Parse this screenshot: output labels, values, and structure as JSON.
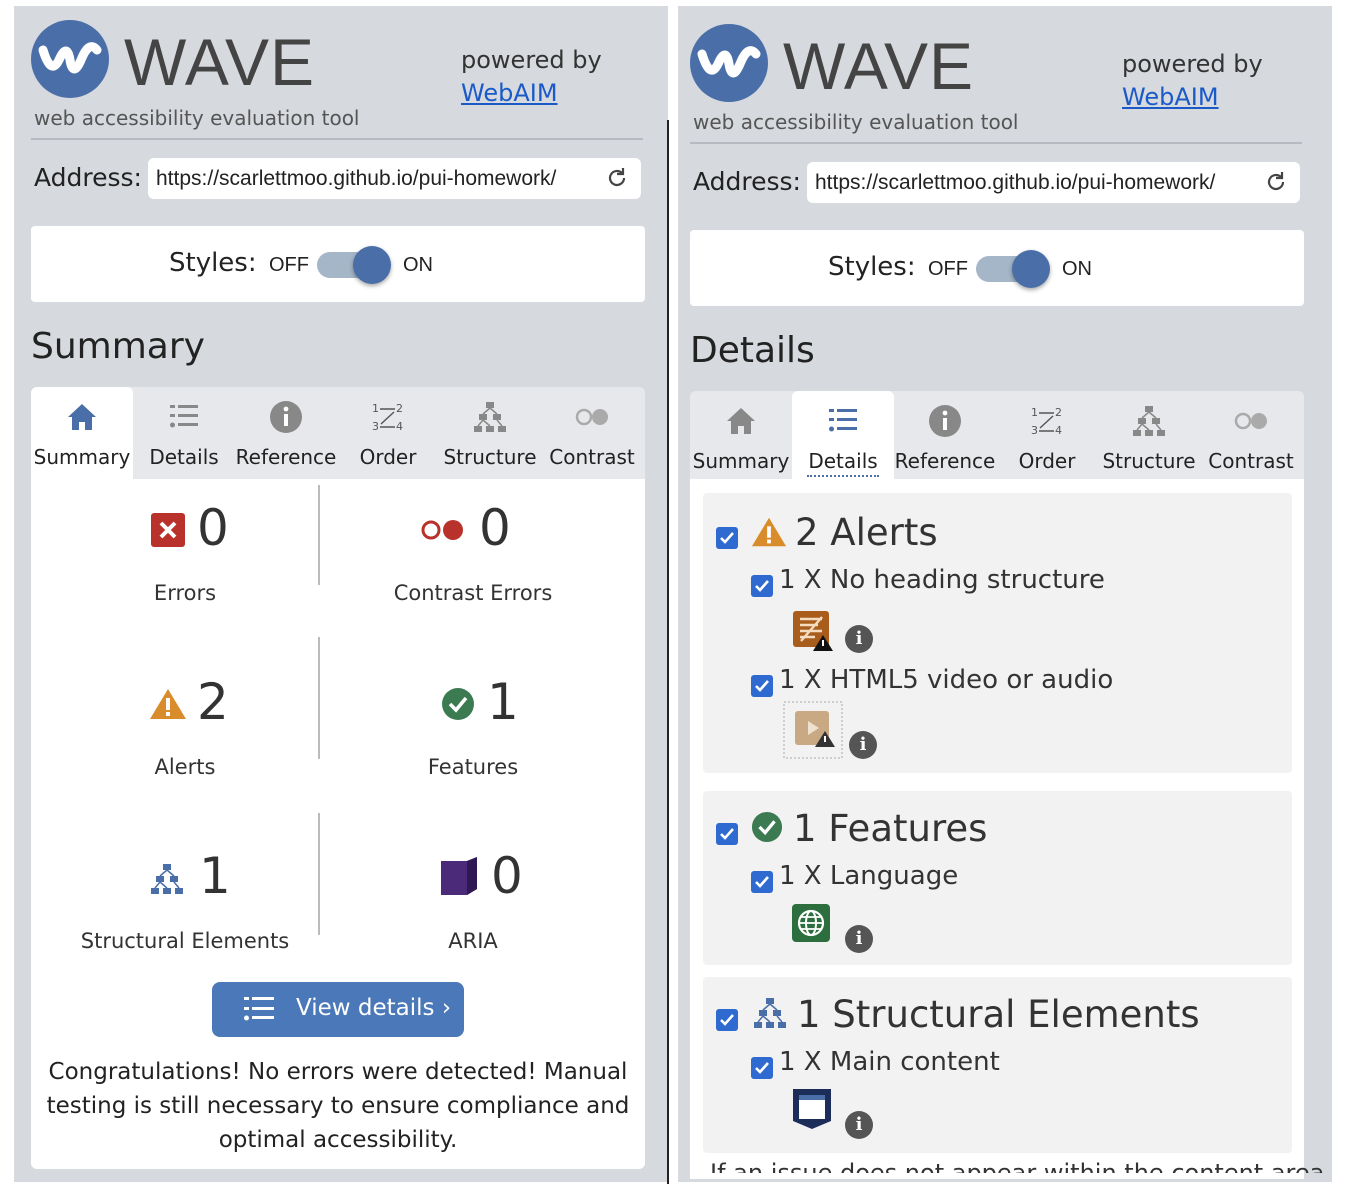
{
  "app": {
    "title": "WAVE",
    "subtitle": "web accessibility evaluation tool",
    "powered_by": "powered by",
    "powered_link": "WebAIM",
    "address_label": "Address:",
    "address_value": "https://scarlettmoo.github.io/pui-homework/",
    "styles_label": "Styles:",
    "styles_off": "OFF",
    "styles_on": "ON",
    "styles_enabled": true
  },
  "tabs": [
    {
      "label": "Summary",
      "icon": "home-icon"
    },
    {
      "label": "Details",
      "icon": "list-icon"
    },
    {
      "label": "Reference",
      "icon": "info-icon"
    },
    {
      "label": "Order",
      "icon": "order-icon"
    },
    {
      "label": "Structure",
      "icon": "structure-icon"
    },
    {
      "label": "Contrast",
      "icon": "contrast-icon"
    }
  ],
  "left": {
    "section_title": "Summary",
    "active_tab": "Summary",
    "stats": [
      {
        "count": "0",
        "label": "Errors",
        "icon": "error-icon"
      },
      {
        "count": "0",
        "label": "Contrast Errors",
        "icon": "contrast-error-icon"
      },
      {
        "count": "2",
        "label": "Alerts",
        "icon": "alert-icon"
      },
      {
        "count": "1",
        "label": "Features",
        "icon": "feature-check-icon"
      },
      {
        "count": "1",
        "label": "Structural Elements",
        "icon": "structure-icon"
      },
      {
        "count": "0",
        "label": "ARIA",
        "icon": "aria-cube-icon"
      }
    ],
    "view_details": "View details ›",
    "congrats": "Congratulations! No errors were detected! Manual testing is still necessary to ensure compliance and optimal accessibility."
  },
  "right": {
    "section_title": "Details",
    "active_tab": "Details",
    "groups": [
      {
        "title": "2 Alerts",
        "icon": "alert-icon",
        "items": [
          {
            "label": "1 X No heading structure",
            "icon": "no-heading-icon"
          },
          {
            "label": "1 X HTML5 video or audio",
            "icon": "video-alert-icon"
          }
        ]
      },
      {
        "title": "1 Features",
        "icon": "feature-check-icon",
        "items": [
          {
            "label": "1 X Language",
            "icon": "globe-icon"
          }
        ]
      },
      {
        "title": "1 Structural Elements",
        "icon": "structure-icon",
        "items": [
          {
            "label": "1 X Main content",
            "icon": "main-content-icon"
          }
        ]
      }
    ],
    "cut_text": "If an issue does not appear within the content area of..."
  },
  "colors": {
    "brand_blue": "#4a6fa8",
    "error_red": "#c0392b",
    "alert_orange": "#d98c2b",
    "feature_green": "#3c7a52",
    "aria_purple": "#4b2a7a",
    "checkbox_blue": "#2f6ad0"
  }
}
